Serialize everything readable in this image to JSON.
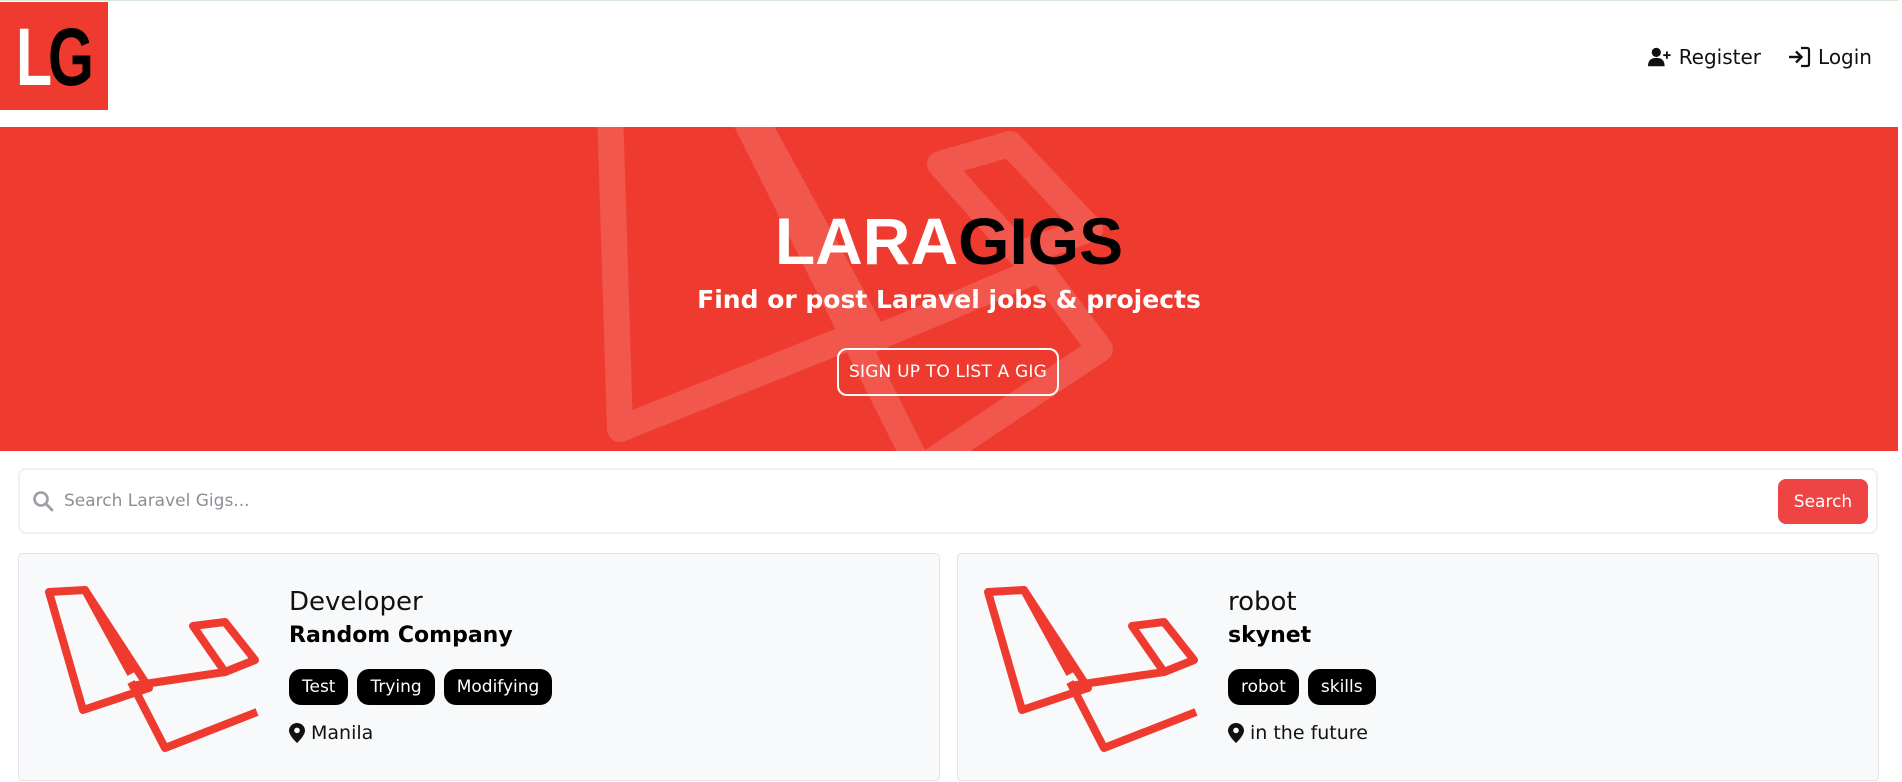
{
  "brand": {
    "logo_left": "L",
    "logo_right": "G"
  },
  "nav": {
    "register_label": "Register",
    "login_label": "Login"
  },
  "hero": {
    "title_part1": "LARA",
    "title_part2": "GIGS",
    "subtitle": "Find or post Laravel jobs & projects",
    "cta_label": "Sign Up to List a Gig"
  },
  "search": {
    "placeholder": "Search Laravel Gigs...",
    "value": "",
    "button_label": "Search"
  },
  "listings": [
    {
      "title": "Developer",
      "company": "Random Company",
      "tags": [
        "Test",
        "Trying",
        "Modifying"
      ],
      "location": "Manila"
    },
    {
      "title": "robot",
      "company": "skynet",
      "tags": [
        "robot",
        "skills"
      ],
      "location": "in the future"
    }
  ],
  "colors": {
    "accent": "#ef3b2f",
    "search_button": "#ef4444",
    "tag_bg": "#000000",
    "card_bg": "#f8f9fa"
  },
  "icons": [
    "user-plus-icon",
    "sign-in-icon",
    "search-icon",
    "laravel-logo-icon",
    "map-marker-icon"
  ]
}
